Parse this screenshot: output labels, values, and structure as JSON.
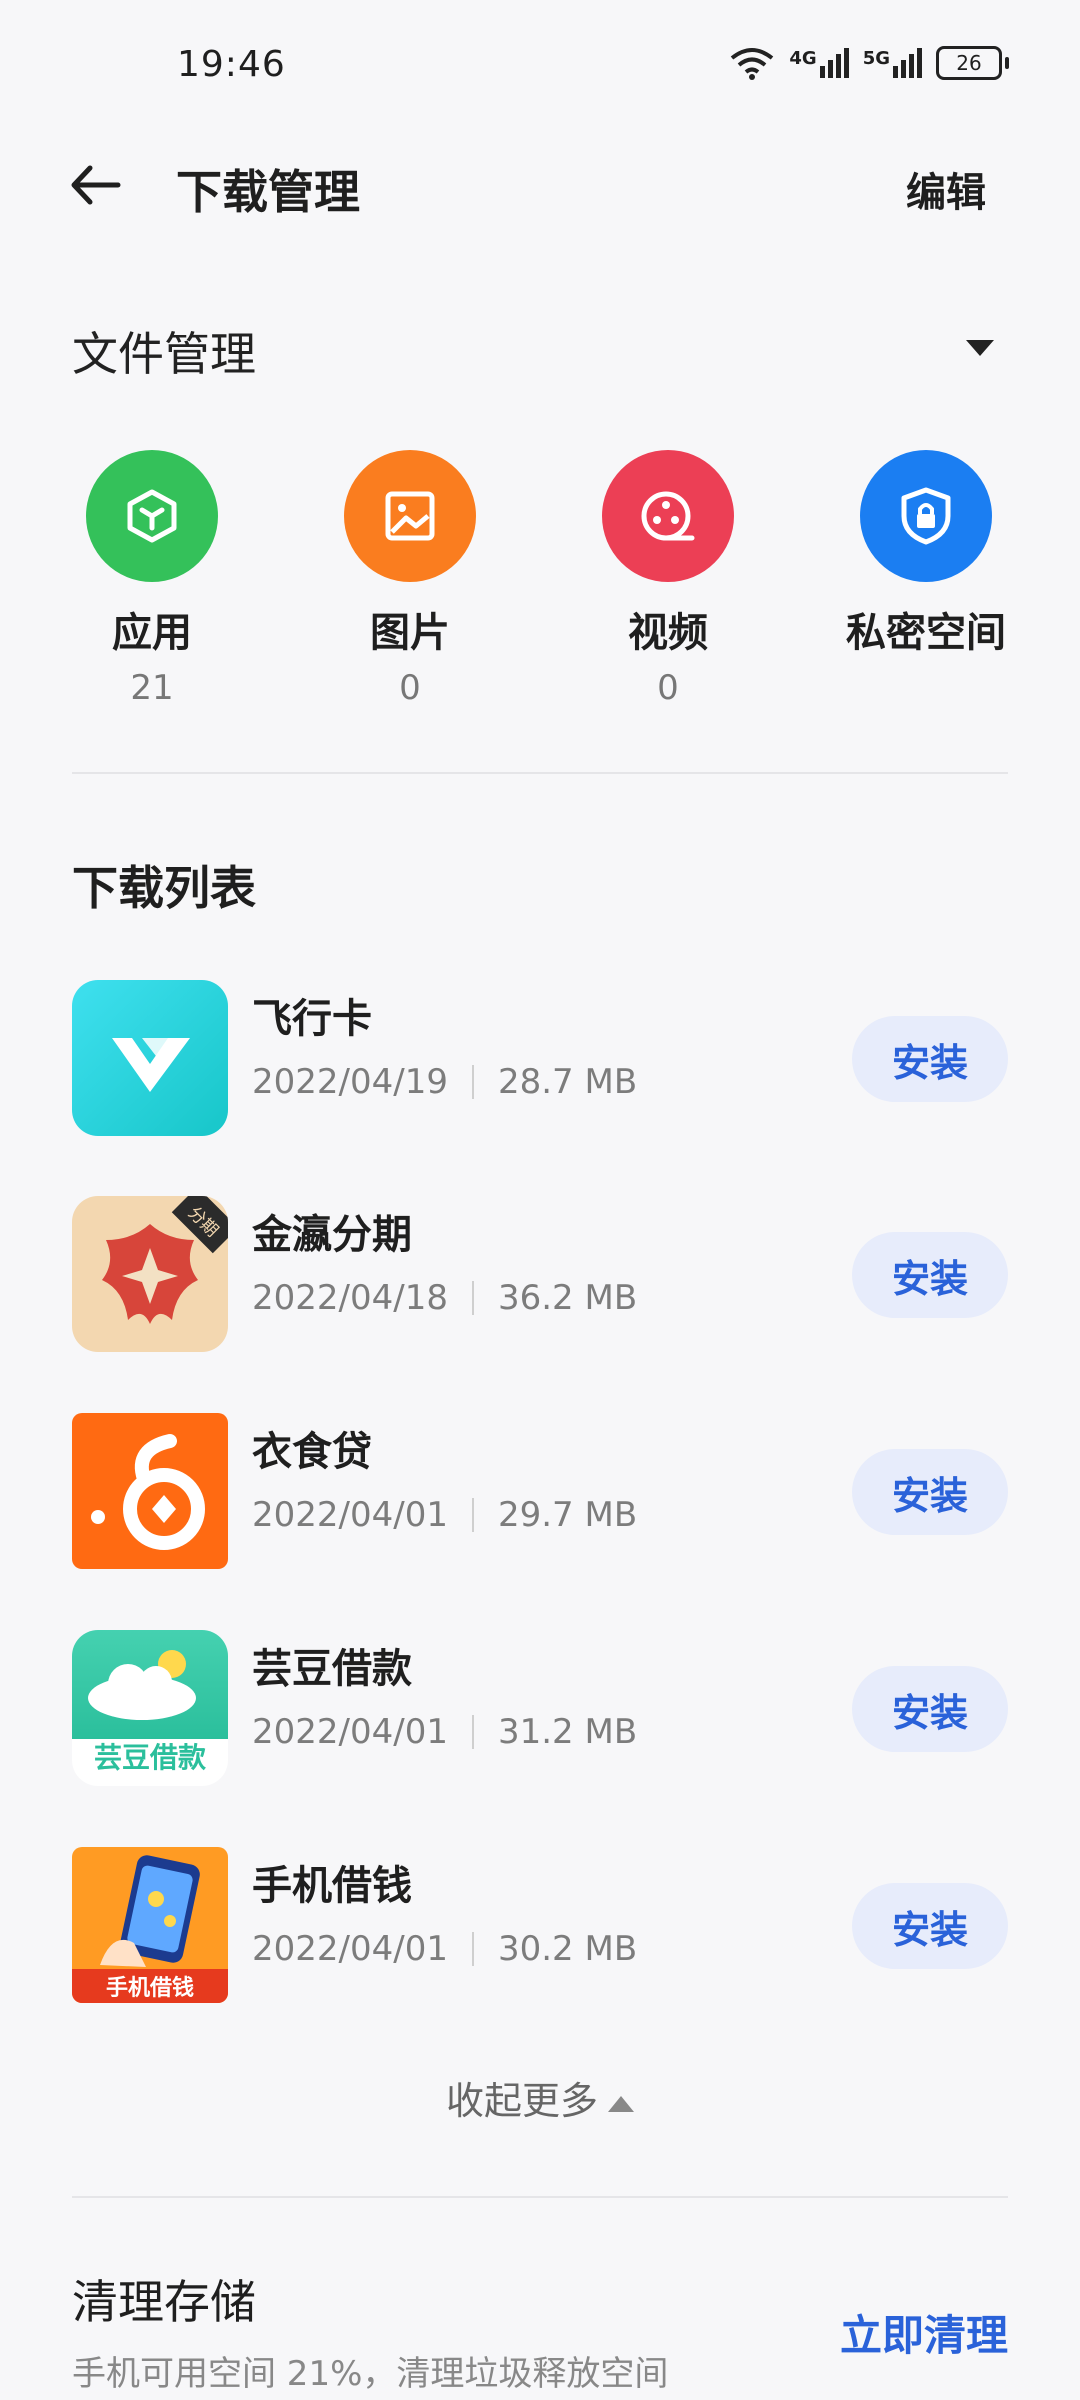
{
  "status_bar": {
    "time": "19:46",
    "network_1": "4G",
    "network_2": "5G",
    "battery": "26"
  },
  "header": {
    "title": "下载管理",
    "edit_label": "编辑"
  },
  "file_management": {
    "title": "文件管理",
    "categories": [
      {
        "label": "应用",
        "count": "21",
        "color": "#34c15a",
        "icon": "cube-icon"
      },
      {
        "label": "图片",
        "count": "0",
        "color": "#fa7d1f",
        "icon": "image-icon"
      },
      {
        "label": "视频",
        "count": "0",
        "color": "#ec3f55",
        "icon": "film-reel-icon"
      },
      {
        "label": "私密空间",
        "count": "",
        "color": "#1b7ef2",
        "icon": "lock-shield-icon"
      }
    ]
  },
  "download_list": {
    "title": "下载列表",
    "items": [
      {
        "name": "飞行卡",
        "date": "2022/04/19",
        "size": "28.7 MB",
        "action": "安装"
      },
      {
        "name": "金瀛分期",
        "date": "2022/04/18",
        "size": "36.2 MB",
        "action": "安装",
        "badge": "分期"
      },
      {
        "name": "衣食贷",
        "date": "2022/04/01",
        "size": "29.7 MB",
        "action": "安装"
      },
      {
        "name": "芸豆借款",
        "date": "2022/04/01",
        "size": "31.2 MB",
        "action": "安装",
        "icon_text": "芸豆借款"
      },
      {
        "name": "手机借钱",
        "date": "2022/04/01",
        "size": "30.2 MB",
        "action": "安装",
        "icon_text": "手机借钱"
      }
    ],
    "collapse_label": "收起更多"
  },
  "storage": {
    "title": "清理存储",
    "description": "手机可用空间 21%，清理垃圾释放空间",
    "action": "立即清理"
  }
}
